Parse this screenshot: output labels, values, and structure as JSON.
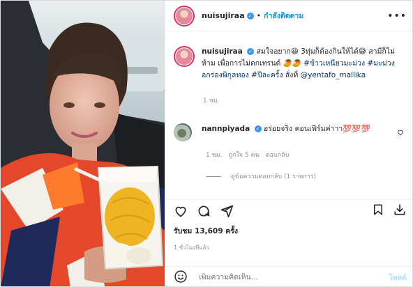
{
  "post": {
    "author": "nuisujiraa",
    "follow_status": "กำลังติดตาม",
    "caption_user": "nuisujiraa",
    "caption_text": "สมใจอยาก😆 3ทุ่มก็ต้องกินให้ได้😅 สามีก็ไม่ห้าม เพื่อการไม่ตกเทรนด์ 🥭🥭",
    "hashtags": [
      "#ข้าวเหนียวมะม่วง",
      "#มะม่วงอกร่องพิกุลทอง",
      "#ปีละครั้ง"
    ],
    "caption_tail": "สั่งที่",
    "mention": "@yentafo_mallika",
    "caption_age": "1 ชม."
  },
  "comment": {
    "user": "nannpiyada",
    "text": "อร่อยจริง คอนเฟิร์มค่าาา💯💯💯",
    "age": "1 ชม.",
    "likes": "ถูกใจ 5 คน",
    "reply_label": "ตอบกลับ",
    "view_replies": "ดูข้อความตอบกลับ (1 รายการ)"
  },
  "stats": {
    "likes_text": "รับชม 13,609 ครั้ง",
    "posted": "1 ชั่วโมงที่แล้ว"
  },
  "composer": {
    "placeholder": "เพิ่มความคิดเห็น...",
    "post_label": "โพสต์"
  },
  "icons": {
    "more": "more-options-icon",
    "verified": "verified-badge-icon",
    "like": "heart-icon",
    "comment": "comment-bubble-icon",
    "share": "send-icon",
    "save": "bookmark-icon",
    "download": "download-icon",
    "emoji": "emoji-icon"
  },
  "colors": {
    "link": "#00376b",
    "follow": "#0095f6",
    "verified": "#3897f0",
    "muted": "#8e8e8e"
  }
}
